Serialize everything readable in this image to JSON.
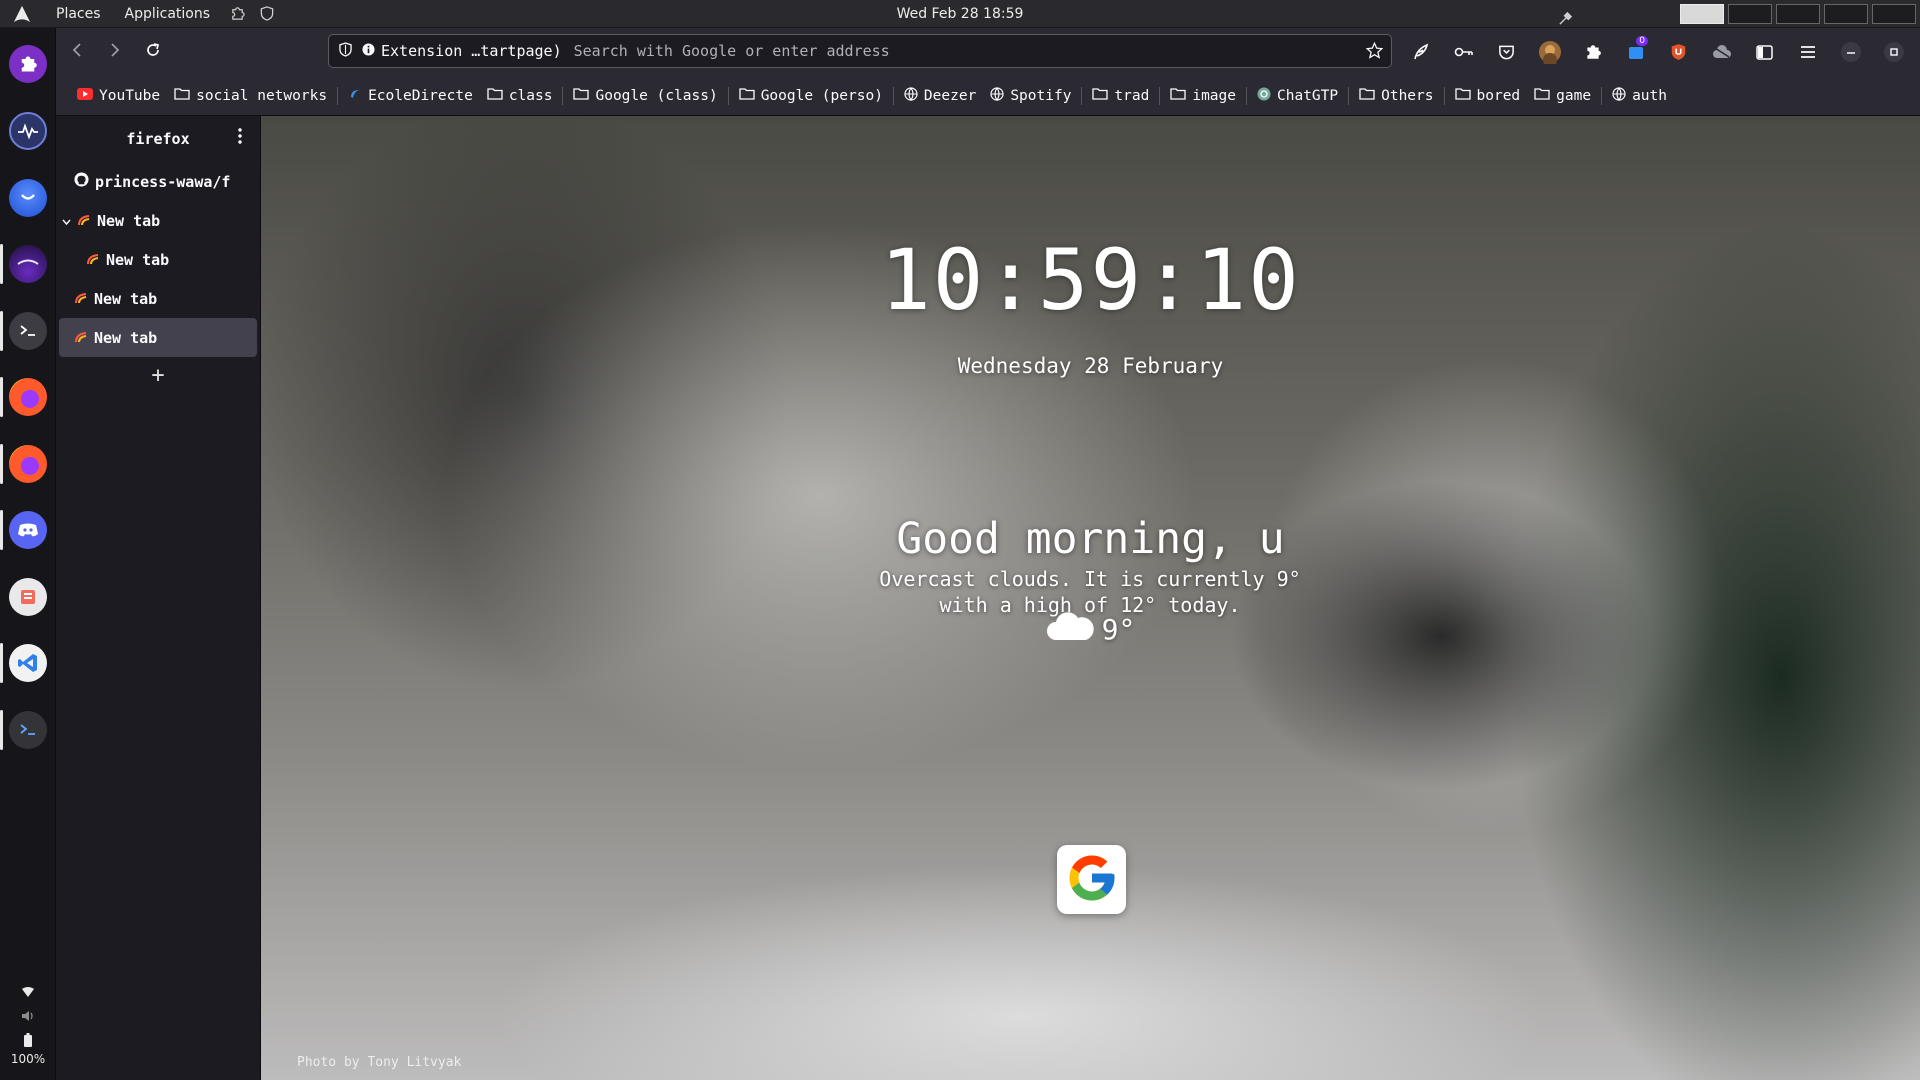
{
  "top_panel": {
    "menus": [
      "Places",
      "Applications"
    ],
    "clock": "Wed Feb 28 18:59",
    "icons": [
      "arch-logo-icon",
      "extension-puzzle-icon",
      "shield-icon",
      "color-picker-icon"
    ],
    "workspaces": [
      {
        "active": true
      },
      {
        "active": false
      },
      {
        "active": false
      },
      {
        "active": false
      },
      {
        "active": false
      }
    ]
  },
  "dock": {
    "apps": [
      {
        "name": "extensions-app",
        "color": "#8e3bd6"
      },
      {
        "name": "system-monitor-app",
        "color": "#3a4a8a"
      },
      {
        "name": "firefox-nightly-app",
        "color": "#2b60e6"
      },
      {
        "name": "firefox-dev-app",
        "color": "#3b1e6b"
      },
      {
        "name": "terminal-app",
        "color": "#3a3a40"
      },
      {
        "name": "firefox-app",
        "color": "#ff7a1a"
      },
      {
        "name": "firefox-app-2",
        "color": "#ff7a1a"
      },
      {
        "name": "discord-app",
        "color": "#5865f2"
      },
      {
        "name": "software-app",
        "color": "#e8e8e8"
      },
      {
        "name": "vscodium-app",
        "color": "#2f80ed"
      },
      {
        "name": "terminal-app-2",
        "color": "#333338"
      }
    ],
    "battery_percent": "100%"
  },
  "browser": {
    "urlbar": {
      "identity": "Extension …tartpage)",
      "placeholder": "Search with Google or enter address"
    },
    "toolbar_icons": [
      "feather-icon",
      "key-icon",
      "pocket-icon",
      "account-icon",
      "extensions-icon",
      "ublock-icon",
      "brave-icon",
      "cloud-icon",
      "sidebar-icon",
      "menu-icon",
      "minimize-icon",
      "maximize-icon",
      "close-icon"
    ],
    "notification_badge": "0",
    "bookmarks": [
      {
        "label": "YouTube",
        "icon": "youtube-icon"
      },
      {
        "label": "social networks",
        "icon": "folder-icon"
      },
      {
        "label": "EcoleDirecte",
        "icon": "ecoledirecte-icon"
      },
      {
        "label": "class",
        "icon": "folder-icon"
      },
      {
        "label": "Google (class)",
        "icon": "folder-icon"
      },
      {
        "label": "Google (perso)",
        "icon": "folder-icon"
      },
      {
        "label": "Deezer",
        "icon": "globe-icon"
      },
      {
        "label": "Spotify",
        "icon": "globe-icon"
      },
      {
        "label": "trad",
        "icon": "folder-icon"
      },
      {
        "label": "image",
        "icon": "folder-icon"
      },
      {
        "label": "ChatGTP",
        "icon": "chatgpt-icon"
      },
      {
        "label": "Others",
        "icon": "folder-icon"
      },
      {
        "label": "bored",
        "icon": "folder-icon"
      },
      {
        "label": "game",
        "icon": "folder-icon"
      },
      {
        "label": "auth",
        "icon": "globe-icon"
      }
    ]
  },
  "tab_sidebar": {
    "title": "firefox",
    "tabs": [
      {
        "label": "princess-wawa/f",
        "icon": "github-icon",
        "indent": 0
      },
      {
        "label": "New tab",
        "icon": "newtab-icon",
        "indent": 0,
        "expanded": true
      },
      {
        "label": "New tab",
        "icon": "newtab-icon",
        "indent": 1
      },
      {
        "label": "New tab",
        "icon": "newtab-icon",
        "indent": 0
      },
      {
        "label": "New tab",
        "icon": "newtab-icon",
        "indent": 0,
        "active": true
      }
    ],
    "add_symbol": "+"
  },
  "startpage": {
    "time": "10:59:10",
    "date": "Wednesday 28 February",
    "greeting": "Good morning, u",
    "weather_line1": "Overcast clouds. It is currently 9°",
    "weather_line2": "with a high of 12° today.",
    "temperature": "9°",
    "shortcut": "google-icon",
    "photo_credit": "Photo by Tony Litvyak"
  }
}
